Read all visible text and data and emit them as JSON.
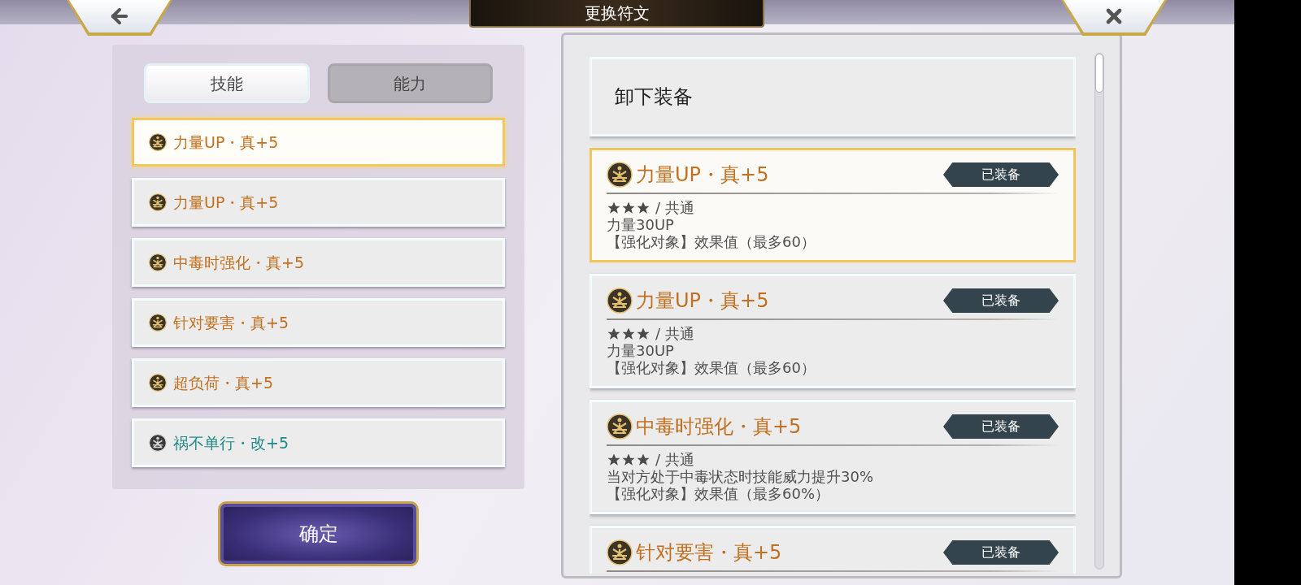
{
  "header": {
    "title": "更换符文"
  },
  "tabs": [
    {
      "label": "技能",
      "selected": true
    },
    {
      "label": "能力",
      "selected": false
    }
  ],
  "rune_list": [
    {
      "name": "力量UP・真+5",
      "kind": "gold",
      "selected": true
    },
    {
      "name": "力量UP・真+5",
      "kind": "gold",
      "selected": false
    },
    {
      "name": "中毒时强化・真+5",
      "kind": "gold",
      "selected": false
    },
    {
      "name": "针对要害・真+5",
      "kind": "gold",
      "selected": false
    },
    {
      "name": "超负荷・真+5",
      "kind": "gold",
      "selected": false
    },
    {
      "name": "祸不单行・改+5",
      "kind": "silver",
      "selected": false
    }
  ],
  "confirm_button": "确定",
  "unequip_button": "卸下装备",
  "rune_cards": [
    {
      "name": "力量UP・真+5",
      "kind": "gold",
      "selected": true,
      "badge": "已装备",
      "stars": 3,
      "category_text": "/ 共通",
      "lines": [
        "力量30UP",
        "【强化对象】效果值（最多60）"
      ]
    },
    {
      "name": "力量UP・真+5",
      "kind": "gold",
      "selected": false,
      "badge": "已装备",
      "stars": 3,
      "category_text": "/ 共通",
      "lines": [
        "力量30UP",
        "【强化对象】效果值（最多60）"
      ]
    },
    {
      "name": "中毒时强化・真+5",
      "kind": "gold",
      "selected": false,
      "badge": "已装备",
      "stars": 3,
      "category_text": "/ 共通",
      "lines": [
        "当对方处于中毒状态时技能威力提升30%",
        "【强化对象】效果值（最多60%）"
      ]
    },
    {
      "name": "针对要害・真+5",
      "kind": "gold",
      "selected": false,
      "badge": "已装备"
    }
  ]
}
